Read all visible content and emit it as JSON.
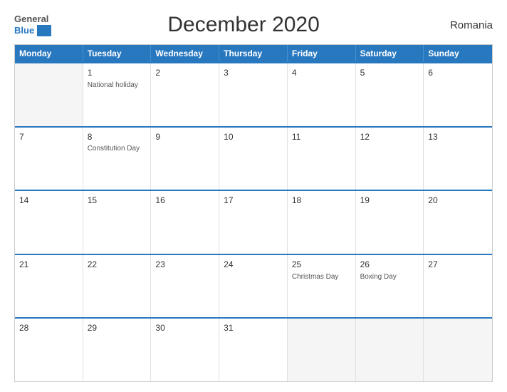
{
  "header": {
    "logo_general": "General",
    "logo_blue": "Blue",
    "title": "December 2020",
    "country": "Romania"
  },
  "weekdays": [
    "Monday",
    "Tuesday",
    "Wednesday",
    "Thursday",
    "Friday",
    "Saturday",
    "Sunday"
  ],
  "weeks": [
    [
      {
        "day": "",
        "holiday": "",
        "empty": true
      },
      {
        "day": "1",
        "holiday": "National holiday",
        "empty": false
      },
      {
        "day": "2",
        "holiday": "",
        "empty": false
      },
      {
        "day": "3",
        "holiday": "",
        "empty": false
      },
      {
        "day": "4",
        "holiday": "",
        "empty": false
      },
      {
        "day": "5",
        "holiday": "",
        "empty": false
      },
      {
        "day": "6",
        "holiday": "",
        "empty": false
      }
    ],
    [
      {
        "day": "7",
        "holiday": "",
        "empty": false
      },
      {
        "day": "8",
        "holiday": "Constitution Day",
        "empty": false
      },
      {
        "day": "9",
        "holiday": "",
        "empty": false
      },
      {
        "day": "10",
        "holiday": "",
        "empty": false
      },
      {
        "day": "11",
        "holiday": "",
        "empty": false
      },
      {
        "day": "12",
        "holiday": "",
        "empty": false
      },
      {
        "day": "13",
        "holiday": "",
        "empty": false
      }
    ],
    [
      {
        "day": "14",
        "holiday": "",
        "empty": false
      },
      {
        "day": "15",
        "holiday": "",
        "empty": false
      },
      {
        "day": "16",
        "holiday": "",
        "empty": false
      },
      {
        "day": "17",
        "holiday": "",
        "empty": false
      },
      {
        "day": "18",
        "holiday": "",
        "empty": false
      },
      {
        "day": "19",
        "holiday": "",
        "empty": false
      },
      {
        "day": "20",
        "holiday": "",
        "empty": false
      }
    ],
    [
      {
        "day": "21",
        "holiday": "",
        "empty": false
      },
      {
        "day": "22",
        "holiday": "",
        "empty": false
      },
      {
        "day": "23",
        "holiday": "",
        "empty": false
      },
      {
        "day": "24",
        "holiday": "",
        "empty": false
      },
      {
        "day": "25",
        "holiday": "Christmas Day",
        "empty": false
      },
      {
        "day": "26",
        "holiday": "Boxing Day",
        "empty": false
      },
      {
        "day": "27",
        "holiday": "",
        "empty": false
      }
    ],
    [
      {
        "day": "28",
        "holiday": "",
        "empty": false
      },
      {
        "day": "29",
        "holiday": "",
        "empty": false
      },
      {
        "day": "30",
        "holiday": "",
        "empty": false
      },
      {
        "day": "31",
        "holiday": "",
        "empty": false
      },
      {
        "day": "",
        "holiday": "",
        "empty": true
      },
      {
        "day": "",
        "holiday": "",
        "empty": true
      },
      {
        "day": "",
        "holiday": "",
        "empty": true
      }
    ]
  ]
}
